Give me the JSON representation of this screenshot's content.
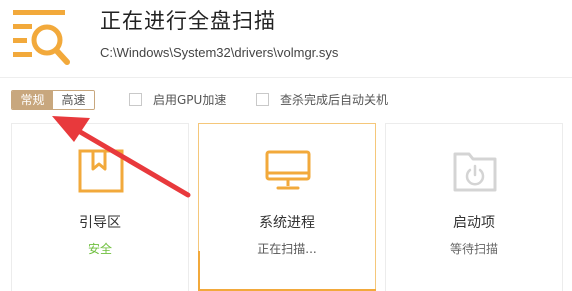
{
  "header": {
    "title": "正在进行全盘扫描",
    "path": "C:\\Windows\\System32\\drivers\\volmgr.sys",
    "logo_icon": "scan-magnifier-icon"
  },
  "mode_toggle": {
    "options": [
      "常规",
      "高速"
    ],
    "selected": "常规"
  },
  "options": {
    "gpu": "启用GPU加速",
    "shutdown": "查杀完成后自动关机"
  },
  "cards": [
    {
      "icon": "bookmark-icon",
      "name": "引导区",
      "status": "安全",
      "status_color": "#6fbf3f"
    },
    {
      "icon": "monitor-icon",
      "name": "系统进程",
      "status": "正在扫描...",
      "status_color": "#555555"
    },
    {
      "icon": "startup-folder-icon",
      "name": "启动项",
      "status": "等待扫描",
      "status_color": "#666666"
    }
  ],
  "colors": {
    "accent": "#f2a93b",
    "toggle": "#c8a77e",
    "arrow": "#e8393c"
  }
}
